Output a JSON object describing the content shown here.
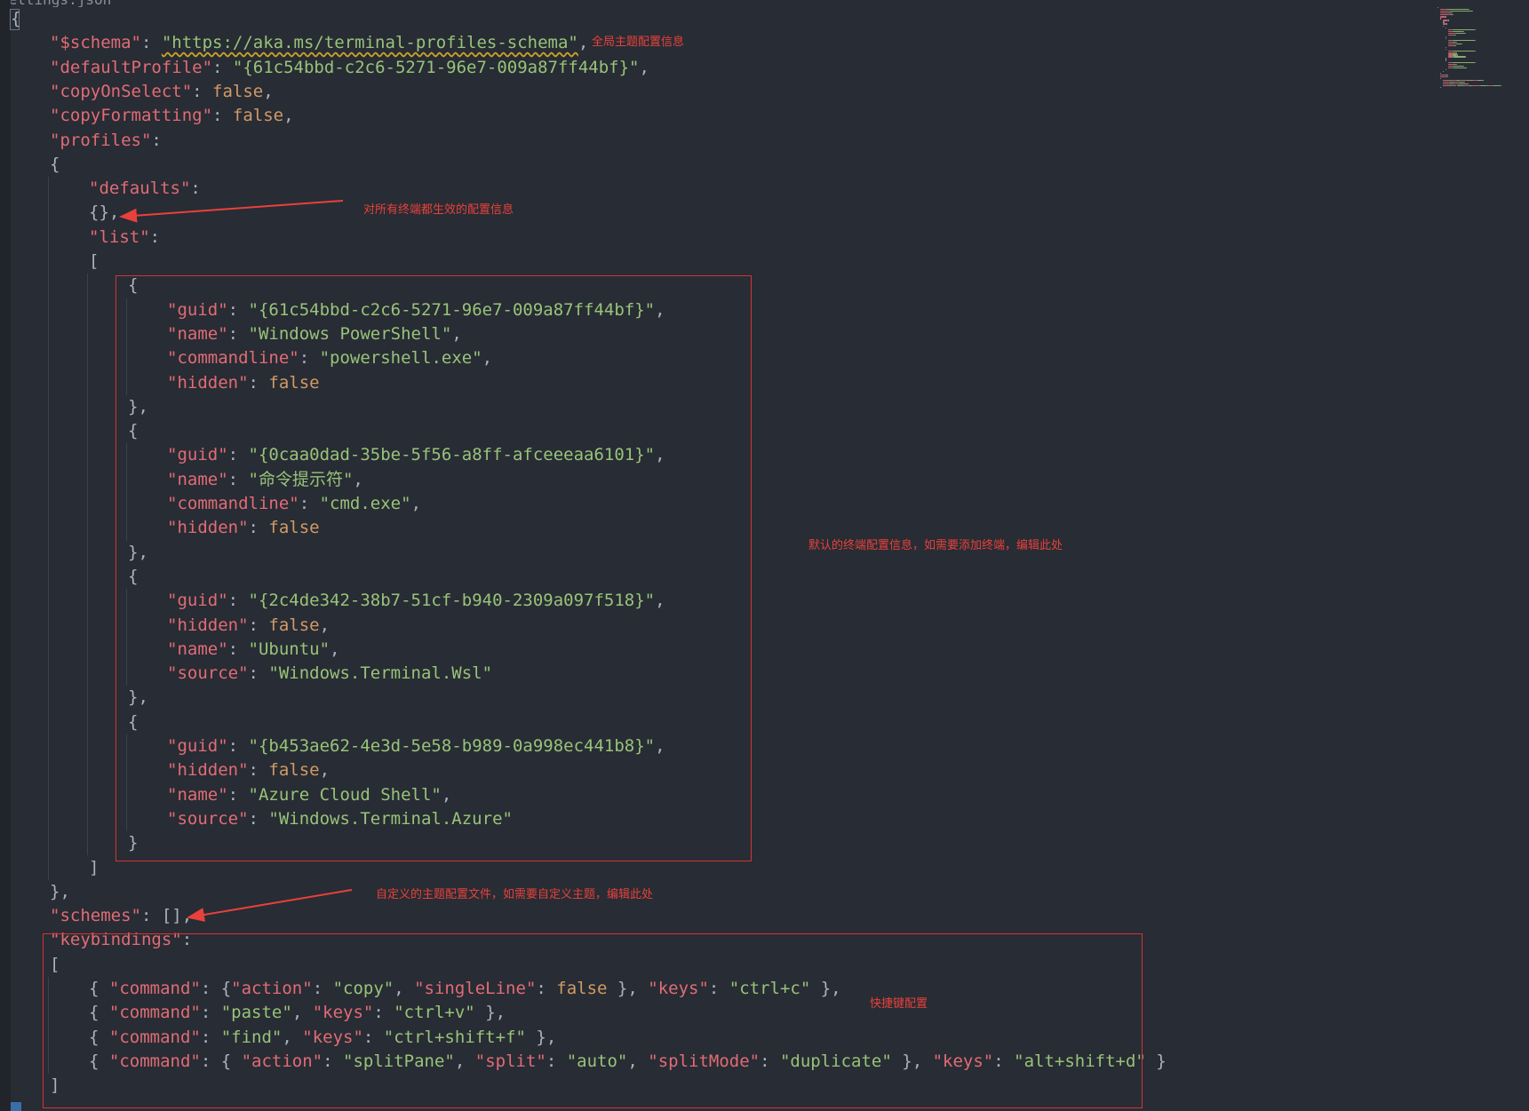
{
  "breadcrumb": "settings.json",
  "colors": {
    "background": "#282c34",
    "key": "#e06c75",
    "string": "#98c379",
    "constant": "#d19a66",
    "punctuation": "#abb2bf",
    "annotation": "#e8413b"
  },
  "code_lines": [
    {
      "indent": 0,
      "tokens": [
        {
          "t": "{",
          "c": "p"
        }
      ]
    },
    {
      "indent": 1,
      "tokens": [
        {
          "t": "\"$schema\"",
          "c": "k"
        },
        {
          "t": ": ",
          "c": "p"
        },
        {
          "t": "\"https://aka.ms/terminal-profiles-schema\"",
          "c": "s u"
        },
        {
          "t": ",",
          "c": "p"
        }
      ]
    },
    {
      "indent": 1,
      "tokens": [
        {
          "t": "\"defaultProfile\"",
          "c": "k"
        },
        {
          "t": ": ",
          "c": "p"
        },
        {
          "t": "\"{61c54bbd-c2c6-5271-96e7-009a87ff44bf}\"",
          "c": "s"
        },
        {
          "t": ",",
          "c": "p"
        }
      ]
    },
    {
      "indent": 1,
      "tokens": [
        {
          "t": "\"copyOnSelect\"",
          "c": "k"
        },
        {
          "t": ": ",
          "c": "p"
        },
        {
          "t": "false",
          "c": "c"
        },
        {
          "t": ",",
          "c": "p"
        }
      ]
    },
    {
      "indent": 1,
      "tokens": [
        {
          "t": "\"copyFormatting\"",
          "c": "k"
        },
        {
          "t": ": ",
          "c": "p"
        },
        {
          "t": "false",
          "c": "c"
        },
        {
          "t": ",",
          "c": "p"
        }
      ]
    },
    {
      "indent": 1,
      "tokens": [
        {
          "t": "\"profiles\"",
          "c": "k"
        },
        {
          "t": ":",
          "c": "p"
        }
      ]
    },
    {
      "indent": 1,
      "tokens": [
        {
          "t": "{",
          "c": "p"
        }
      ]
    },
    {
      "indent": 2,
      "tokens": [
        {
          "t": "\"defaults\"",
          "c": "k"
        },
        {
          "t": ":",
          "c": "p"
        }
      ]
    },
    {
      "indent": 2,
      "tokens": [
        {
          "t": "{},",
          "c": "p"
        }
      ]
    },
    {
      "indent": 2,
      "tokens": [
        {
          "t": "\"list\"",
          "c": "k"
        },
        {
          "t": ":",
          "c": "p"
        }
      ]
    },
    {
      "indent": 2,
      "tokens": [
        {
          "t": "[",
          "c": "p"
        }
      ]
    },
    {
      "indent": 3,
      "tokens": [
        {
          "t": "{",
          "c": "p"
        }
      ]
    },
    {
      "indent": 4,
      "tokens": [
        {
          "t": "\"guid\"",
          "c": "k"
        },
        {
          "t": ": ",
          "c": "p"
        },
        {
          "t": "\"{61c54bbd-c2c6-5271-96e7-009a87ff44bf}\"",
          "c": "s"
        },
        {
          "t": ",",
          "c": "p"
        }
      ]
    },
    {
      "indent": 4,
      "tokens": [
        {
          "t": "\"name\"",
          "c": "k"
        },
        {
          "t": ": ",
          "c": "p"
        },
        {
          "t": "\"Windows PowerShell\"",
          "c": "s"
        },
        {
          "t": ",",
          "c": "p"
        }
      ]
    },
    {
      "indent": 4,
      "tokens": [
        {
          "t": "\"commandline\"",
          "c": "k"
        },
        {
          "t": ": ",
          "c": "p"
        },
        {
          "t": "\"powershell.exe\"",
          "c": "s"
        },
        {
          "t": ",",
          "c": "p"
        }
      ]
    },
    {
      "indent": 4,
      "tokens": [
        {
          "t": "\"hidden\"",
          "c": "k"
        },
        {
          "t": ": ",
          "c": "p"
        },
        {
          "t": "false",
          "c": "c"
        }
      ]
    },
    {
      "indent": 3,
      "tokens": [
        {
          "t": "},",
          "c": "p"
        }
      ]
    },
    {
      "indent": 3,
      "tokens": [
        {
          "t": "{",
          "c": "p"
        }
      ]
    },
    {
      "indent": 4,
      "tokens": [
        {
          "t": "\"guid\"",
          "c": "k"
        },
        {
          "t": ": ",
          "c": "p"
        },
        {
          "t": "\"{0caa0dad-35be-5f56-a8ff-afceeeaa6101}\"",
          "c": "s"
        },
        {
          "t": ",",
          "c": "p"
        }
      ]
    },
    {
      "indent": 4,
      "tokens": [
        {
          "t": "\"name\"",
          "c": "k"
        },
        {
          "t": ": ",
          "c": "p"
        },
        {
          "t": "\"命令提示符\"",
          "c": "s"
        },
        {
          "t": ",",
          "c": "p"
        }
      ]
    },
    {
      "indent": 4,
      "tokens": [
        {
          "t": "\"commandline\"",
          "c": "k"
        },
        {
          "t": ": ",
          "c": "p"
        },
        {
          "t": "\"cmd.exe\"",
          "c": "s"
        },
        {
          "t": ",",
          "c": "p"
        }
      ]
    },
    {
      "indent": 4,
      "tokens": [
        {
          "t": "\"hidden\"",
          "c": "k"
        },
        {
          "t": ": ",
          "c": "p"
        },
        {
          "t": "false",
          "c": "c"
        }
      ]
    },
    {
      "indent": 3,
      "tokens": [
        {
          "t": "},",
          "c": "p"
        }
      ]
    },
    {
      "indent": 3,
      "tokens": [
        {
          "t": "{",
          "c": "p"
        }
      ]
    },
    {
      "indent": 4,
      "tokens": [
        {
          "t": "\"guid\"",
          "c": "k"
        },
        {
          "t": ": ",
          "c": "p"
        },
        {
          "t": "\"{2c4de342-38b7-51cf-b940-2309a097f518}\"",
          "c": "s"
        },
        {
          "t": ",",
          "c": "p"
        }
      ]
    },
    {
      "indent": 4,
      "tokens": [
        {
          "t": "\"hidden\"",
          "c": "k"
        },
        {
          "t": ": ",
          "c": "p"
        },
        {
          "t": "false",
          "c": "c"
        },
        {
          "t": ",",
          "c": "p"
        }
      ]
    },
    {
      "indent": 4,
      "tokens": [
        {
          "t": "\"name\"",
          "c": "k"
        },
        {
          "t": ": ",
          "c": "p"
        },
        {
          "t": "\"Ubuntu\"",
          "c": "s"
        },
        {
          "t": ",",
          "c": "p"
        }
      ]
    },
    {
      "indent": 4,
      "tokens": [
        {
          "t": "\"source\"",
          "c": "k"
        },
        {
          "t": ": ",
          "c": "p"
        },
        {
          "t": "\"Windows.Terminal.Wsl\"",
          "c": "s"
        }
      ]
    },
    {
      "indent": 3,
      "tokens": [
        {
          "t": "},",
          "c": "p"
        }
      ]
    },
    {
      "indent": 3,
      "tokens": [
        {
          "t": "{",
          "c": "p"
        }
      ]
    },
    {
      "indent": 4,
      "tokens": [
        {
          "t": "\"guid\"",
          "c": "k"
        },
        {
          "t": ": ",
          "c": "p"
        },
        {
          "t": "\"{b453ae62-4e3d-5e58-b989-0a998ec441b8}\"",
          "c": "s"
        },
        {
          "t": ",",
          "c": "p"
        }
      ]
    },
    {
      "indent": 4,
      "tokens": [
        {
          "t": "\"hidden\"",
          "c": "k"
        },
        {
          "t": ": ",
          "c": "p"
        },
        {
          "t": "false",
          "c": "c"
        },
        {
          "t": ",",
          "c": "p"
        }
      ]
    },
    {
      "indent": 4,
      "tokens": [
        {
          "t": "\"name\"",
          "c": "k"
        },
        {
          "t": ": ",
          "c": "p"
        },
        {
          "t": "\"Azure Cloud Shell\"",
          "c": "s"
        },
        {
          "t": ",",
          "c": "p"
        }
      ]
    },
    {
      "indent": 4,
      "tokens": [
        {
          "t": "\"source\"",
          "c": "k"
        },
        {
          "t": ": ",
          "c": "p"
        },
        {
          "t": "\"Windows.Terminal.Azure\"",
          "c": "s"
        }
      ]
    },
    {
      "indent": 3,
      "tokens": [
        {
          "t": "}",
          "c": "p"
        }
      ]
    },
    {
      "indent": 2,
      "tokens": [
        {
          "t": "]",
          "c": "p"
        }
      ]
    },
    {
      "indent": 1,
      "tokens": [
        {
          "t": "},",
          "c": "p"
        }
      ]
    },
    {
      "indent": 1,
      "tokens": [
        {
          "t": "\"schemes\"",
          "c": "k"
        },
        {
          "t": ": [],",
          "c": "p"
        }
      ]
    },
    {
      "indent": 1,
      "tokens": [
        {
          "t": "\"keybindings\"",
          "c": "k"
        },
        {
          "t": ":",
          "c": "p"
        }
      ]
    },
    {
      "indent": 1,
      "tokens": [
        {
          "t": "[",
          "c": "p"
        }
      ]
    },
    {
      "indent": 2,
      "tokens": [
        {
          "t": "{ ",
          "c": "p"
        },
        {
          "t": "\"command\"",
          "c": "k"
        },
        {
          "t": ": {",
          "c": "p"
        },
        {
          "t": "\"action\"",
          "c": "k"
        },
        {
          "t": ": ",
          "c": "p"
        },
        {
          "t": "\"copy\"",
          "c": "s"
        },
        {
          "t": ", ",
          "c": "p"
        },
        {
          "t": "\"singleLine\"",
          "c": "k"
        },
        {
          "t": ": ",
          "c": "p"
        },
        {
          "t": "false",
          "c": "c"
        },
        {
          "t": " }, ",
          "c": "p"
        },
        {
          "t": "\"keys\"",
          "c": "k"
        },
        {
          "t": ": ",
          "c": "p"
        },
        {
          "t": "\"ctrl+c\"",
          "c": "s"
        },
        {
          "t": " },",
          "c": "p"
        }
      ]
    },
    {
      "indent": 2,
      "tokens": [
        {
          "t": "{ ",
          "c": "p"
        },
        {
          "t": "\"command\"",
          "c": "k"
        },
        {
          "t": ": ",
          "c": "p"
        },
        {
          "t": "\"paste\"",
          "c": "s"
        },
        {
          "t": ", ",
          "c": "p"
        },
        {
          "t": "\"keys\"",
          "c": "k"
        },
        {
          "t": ": ",
          "c": "p"
        },
        {
          "t": "\"ctrl+v\"",
          "c": "s"
        },
        {
          "t": " },",
          "c": "p"
        }
      ]
    },
    {
      "indent": 2,
      "tokens": [
        {
          "t": "{ ",
          "c": "p"
        },
        {
          "t": "\"command\"",
          "c": "k"
        },
        {
          "t": ": ",
          "c": "p"
        },
        {
          "t": "\"find\"",
          "c": "s"
        },
        {
          "t": ", ",
          "c": "p"
        },
        {
          "t": "\"keys\"",
          "c": "k"
        },
        {
          "t": ": ",
          "c": "p"
        },
        {
          "t": "\"ctrl+shift+f\"",
          "c": "s"
        },
        {
          "t": " },",
          "c": "p"
        }
      ]
    },
    {
      "indent": 2,
      "tokens": [
        {
          "t": "{ ",
          "c": "p"
        },
        {
          "t": "\"command\"",
          "c": "k"
        },
        {
          "t": ": { ",
          "c": "p"
        },
        {
          "t": "\"action\"",
          "c": "k"
        },
        {
          "t": ": ",
          "c": "p"
        },
        {
          "t": "\"splitPane\"",
          "c": "s"
        },
        {
          "t": ", ",
          "c": "p"
        },
        {
          "t": "\"split\"",
          "c": "k"
        },
        {
          "t": ": ",
          "c": "p"
        },
        {
          "t": "\"auto\"",
          "c": "s"
        },
        {
          "t": ", ",
          "c": "p"
        },
        {
          "t": "\"splitMode\"",
          "c": "k"
        },
        {
          "t": ": ",
          "c": "p"
        },
        {
          "t": "\"duplicate\"",
          "c": "s"
        },
        {
          "t": " }, ",
          "c": "p"
        },
        {
          "t": "\"keys\"",
          "c": "k"
        },
        {
          "t": ": ",
          "c": "p"
        },
        {
          "t": "\"alt+shift+d\"",
          "c": "s"
        },
        {
          "t": " }",
          "c": "p"
        }
      ]
    },
    {
      "indent": 1,
      "tokens": [
        {
          "t": "]",
          "c": "p"
        }
      ]
    }
  ],
  "annotations": {
    "global_theme": "全局主题配置信息",
    "defaults_note": "对所有终端都生效的配置信息",
    "profiles_list_note": "默认的终端配置信息，如需要添加终端，编辑此处",
    "schemes_note": "自定义的主题配置文件，如需要自定义主题，编辑此处",
    "keybindings_note": "快捷键配置"
  }
}
